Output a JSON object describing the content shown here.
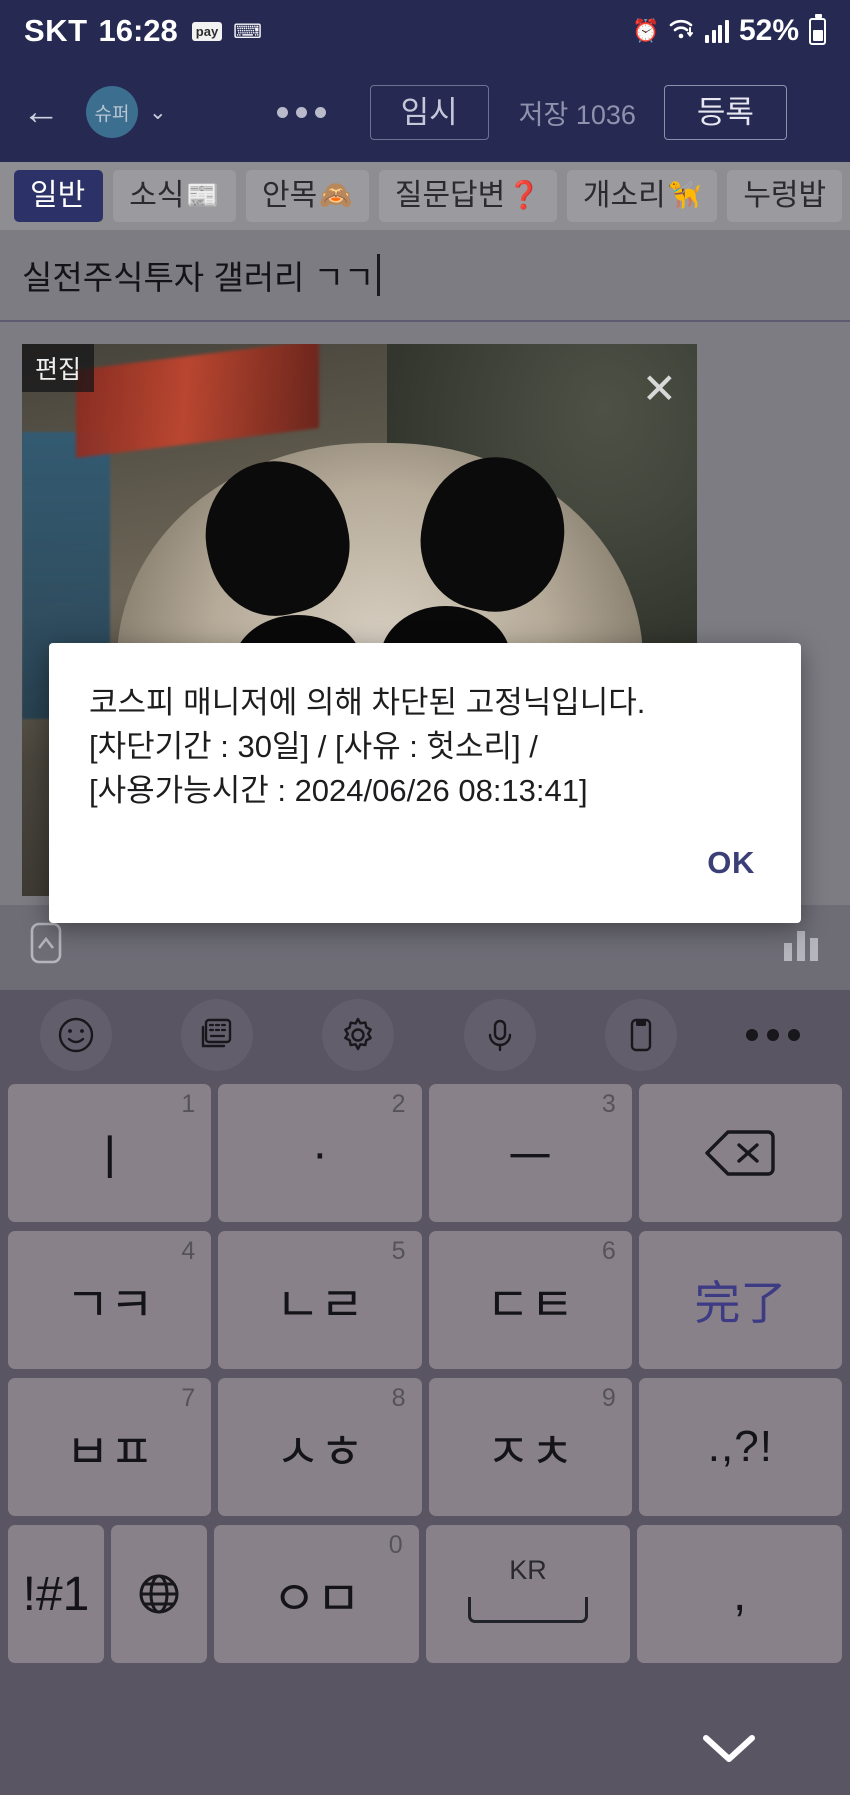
{
  "status_bar": {
    "carrier": "SKT",
    "time": "16:28",
    "pay_badge": "pay",
    "keyboard_icon": "keyboard-icon",
    "alarm_icon": "alarm-icon",
    "wifi_icon": "wifi-icon",
    "signal_icon": "signal-bars-icon",
    "battery_percent": "52%",
    "battery_icon": "battery-icon"
  },
  "app_bar": {
    "back_icon": "back-arrow-icon",
    "avatar_label": "슈퍼",
    "dropdown_icon": "chevron-down-icon",
    "more_icon": "more-horizontal-icon",
    "temp_label": "임시",
    "save_count_label": "저장 1036",
    "submit_label": "등록"
  },
  "tabs": [
    {
      "label": "일반",
      "emoji": "",
      "active": true
    },
    {
      "label": "소식",
      "emoji": "📰",
      "active": false
    },
    {
      "label": "안목",
      "emoji": "🙈",
      "active": false
    },
    {
      "label": "질문답변",
      "emoji": "❓",
      "active": false
    },
    {
      "label": "개소리",
      "emoji": "🦮",
      "active": false
    },
    {
      "label": "누렁밥",
      "emoji": "",
      "active": false
    }
  ],
  "title_field": {
    "value": "실전주식투자 갤러리 ㄱㄱ"
  },
  "attachment": {
    "edit_badge": "편집",
    "close_icon": "close-icon"
  },
  "editor_toolbar": {
    "left_icon": "link-icon",
    "right_icon": "chart-icon"
  },
  "dialog": {
    "lines": [
      "코스피 매니저에 의해 차단된 고정닉입니다.",
      "[차단기간 : 30일] / [사유 : 헛소리] /",
      "[사용가능시간 : 2024/06/26 08:13:41]"
    ],
    "line1": "코스피 매니저에 의해 차단된 고정닉입니다.",
    "line2": "[차단기간 : 30일] / [사유 : 헛소리] /",
    "line3": "[사용가능시간 : 2024/06/26 08:13:41]",
    "ok_label": "OK",
    "ok_color": "#3a3f78"
  },
  "keyboard": {
    "toolbar_icons": [
      "emoji-icon",
      "clipboard-keyboard-icon",
      "gear-icon",
      "microphone-icon",
      "clipboard-icon",
      "more-horizontal-icon"
    ],
    "rows": [
      [
        {
          "label": "ㅣ",
          "num": "1",
          "name": "key-i"
        },
        {
          "label": "·",
          "num": "2",
          "name": "key-dot"
        },
        {
          "label": "ㅡ",
          "num": "3",
          "name": "key-eu"
        },
        {
          "label": "",
          "num": "",
          "name": "backspace-icon"
        }
      ],
      [
        {
          "label": "ㄱㅋ",
          "num": "4",
          "name": "key-giyeok-kieuk"
        },
        {
          "label": "ㄴㄹ",
          "num": "5",
          "name": "key-nieun-rieul"
        },
        {
          "label": "ㄷㅌ",
          "num": "6",
          "name": "key-digeut-tieut"
        },
        {
          "label": "完了",
          "num": "",
          "name": "key-done"
        }
      ],
      [
        {
          "label": "ㅂㅍ",
          "num": "7",
          "name": "key-bieup-pieup"
        },
        {
          "label": "ㅅㅎ",
          "num": "8",
          "name": "key-siot-hieut"
        },
        {
          "label": "ㅈㅊ",
          "num": "9",
          "name": "key-jieut-chieut"
        },
        {
          "label": ".,?!",
          "num": "",
          "name": "key-punctuation"
        }
      ],
      [
        {
          "label": "!#1",
          "num": "",
          "name": "key-symbols"
        },
        {
          "label": "",
          "num": "",
          "name": "globe-icon"
        },
        {
          "label": "ㅇㅁ",
          "num": "0",
          "name": "key-ieung-mieum"
        },
        {
          "label": "KR",
          "num": "",
          "name": "key-space"
        },
        {
          "label": ",",
          "num": "",
          "name": "key-comma"
        }
      ]
    ],
    "hide_keyboard_icon": "chevron-down-icon"
  }
}
